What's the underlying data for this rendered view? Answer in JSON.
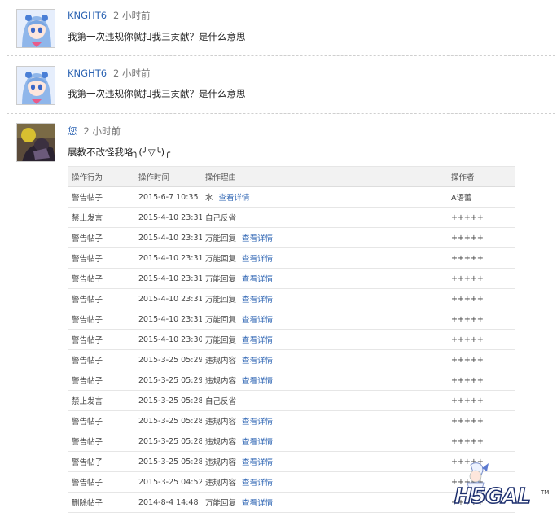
{
  "comments": [
    {
      "user": "KNGHT6",
      "time": "2 小时前",
      "text": "我第一次违规你就扣我三贡献？是什么意思"
    },
    {
      "user": "KNGHT6",
      "time": "2 小时前",
      "text": "我第一次违规你就扣我三贡献？是什么意思"
    },
    {
      "user": "您",
      "time": "2 小时前",
      "text": "展教不改怪我咯╮(╯▽╰)╭"
    }
  ],
  "log": {
    "headers": [
      "操作行为",
      "操作时间",
      "操作理由",
      "",
      "操作者"
    ],
    "detail_label": "查看详情",
    "rows": [
      {
        "action": "警告帖子",
        "time": "2015-6-7 10:35",
        "reason": "水",
        "detail": true,
        "operator": "A语蕾"
      },
      {
        "action": "禁止发言",
        "time": "2015-4-10 23:31",
        "reason": "自己反省",
        "detail": false,
        "operator": "+++++"
      },
      {
        "action": "警告帖子",
        "time": "2015-4-10 23:31",
        "reason": "万能回复",
        "detail": true,
        "operator": "+++++"
      },
      {
        "action": "警告帖子",
        "time": "2015-4-10 23:31",
        "reason": "万能回复",
        "detail": true,
        "operator": "+++++"
      },
      {
        "action": "警告帖子",
        "time": "2015-4-10 23:31",
        "reason": "万能回复",
        "detail": true,
        "operator": "+++++"
      },
      {
        "action": "警告帖子",
        "time": "2015-4-10 23:31",
        "reason": "万能回复",
        "detail": true,
        "operator": "+++++"
      },
      {
        "action": "警告帖子",
        "time": "2015-4-10 23:31",
        "reason": "万能回复",
        "detail": true,
        "operator": "+++++"
      },
      {
        "action": "警告帖子",
        "time": "2015-4-10 23:30",
        "reason": "万能回复",
        "detail": true,
        "operator": "+++++"
      },
      {
        "action": "警告帖子",
        "time": "2015-3-25 05:29",
        "reason": "违规内容",
        "detail": true,
        "operator": "+++++"
      },
      {
        "action": "警告帖子",
        "time": "2015-3-25 05:29",
        "reason": "违规内容",
        "detail": true,
        "operator": "+++++"
      },
      {
        "action": "禁止发言",
        "time": "2015-3-25 05:28",
        "reason": "自己反省",
        "detail": false,
        "operator": "+++++"
      },
      {
        "action": "警告帖子",
        "time": "2015-3-25 05:28",
        "reason": "违规内容",
        "detail": true,
        "operator": "+++++"
      },
      {
        "action": "警告帖子",
        "time": "2015-3-25 05:28",
        "reason": "违规内容",
        "detail": true,
        "operator": "+++++"
      },
      {
        "action": "警告帖子",
        "time": "2015-3-25 05:28",
        "reason": "违规内容",
        "detail": true,
        "operator": "+++++"
      },
      {
        "action": "警告帖子",
        "time": "2015-3-25 04:52",
        "reason": "违规内容",
        "detail": true,
        "operator": "+++++"
      },
      {
        "action": "删除帖子",
        "time": "2014-8-4 14:48",
        "reason": "万能回复",
        "detail": true,
        "operator": "+++++"
      }
    ]
  },
  "watermark": {
    "text": "H5GAL",
    "tm": "TM"
  },
  "icons": [
    "anime-girl-avatar-icon",
    "dark-character-avatar-icon"
  ]
}
